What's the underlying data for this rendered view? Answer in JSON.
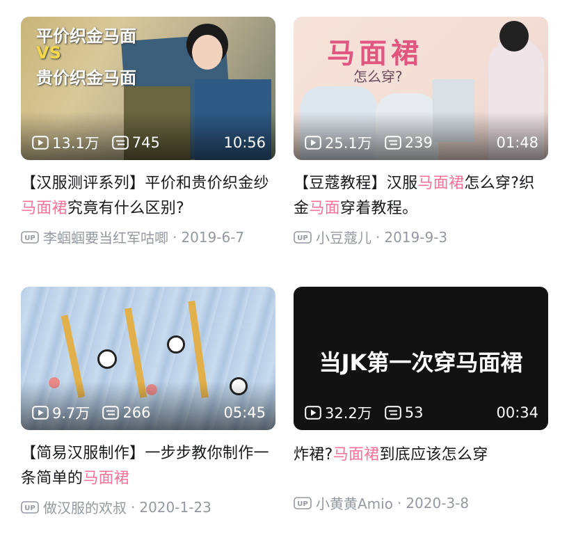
{
  "videos": [
    {
      "title_pre": "【汉服测评系列】平价和贵价织金纱",
      "title_hl": "马面裙",
      "title_post": "究竟有什么区别?",
      "views": "13.1万",
      "danmaku": "745",
      "duration": "10:56",
      "uploader": "李蝈蝈要当红军咕唧",
      "date": "2019-6-7",
      "thumb_text": [
        "平价织金马面",
        "VS",
        "贵价织金马面"
      ]
    },
    {
      "title_pre": "【豆蔻教程】汉服",
      "title_hl": "马面裙",
      "title_mid": "怎么穿?织金",
      "title_hl2": "马面",
      "title_post": "穿着教程。",
      "views": "25.1万",
      "danmaku": "239",
      "duration": "01:48",
      "uploader": "小豆蔻儿",
      "date": "2019-9-3",
      "thumb_text": [
        "马面裙",
        "怎么穿?"
      ]
    },
    {
      "title_pre": "【简易汉服制作】一步步教你制作一条简单的",
      "title_hl": "马面裙",
      "title_post": "",
      "views": "9.7万",
      "danmaku": "266",
      "duration": "05:45",
      "uploader": "做汉服的欢叔",
      "date": "2020-1-23"
    },
    {
      "title_pre": "炸裙?",
      "title_hl": "马面裙",
      "title_post": "到底应该怎么穿",
      "views": "32.2万",
      "danmaku": "53",
      "duration": "00:34",
      "uploader": "小黄黄Amio",
      "date": "2020-3-8",
      "thumb_text": [
        "当JK第一次穿马面裙"
      ]
    }
  ],
  "meta_separator": "·",
  "icons": {
    "views": "play-count-icon",
    "danmaku": "danmaku-icon",
    "uploader": "up-badge-icon"
  },
  "colors": {
    "highlight": "#fb7299",
    "meta": "#9499a0"
  }
}
